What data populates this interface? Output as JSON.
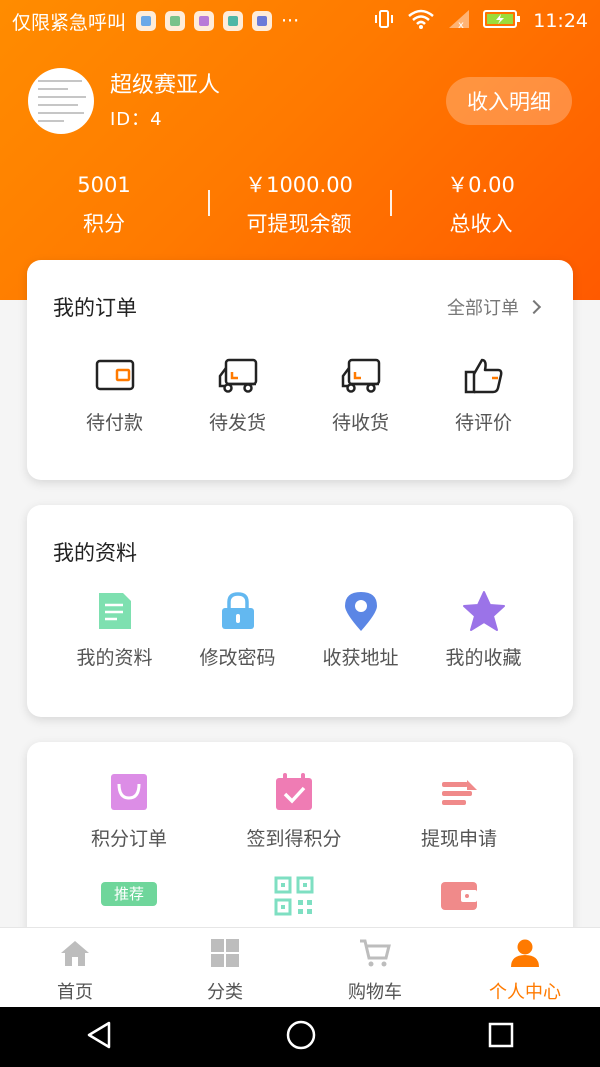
{
  "status_bar": {
    "carrier": "仅限紧急呼叫",
    "dots": "···",
    "time": "11:24"
  },
  "profile": {
    "name": "超级赛亚人",
    "id_text": "ID：4",
    "income_button": "收入明细"
  },
  "stats": [
    {
      "value": "5001",
      "label": "积分"
    },
    {
      "value": "￥1000.00",
      "label": "可提现余额"
    },
    {
      "value": "￥0.00",
      "label": "总收入"
    }
  ],
  "orders": {
    "title": "我的订单",
    "all_orders": "全部订单",
    "items": [
      {
        "label": "待付款",
        "icon": "wallet-icon"
      },
      {
        "label": "待发货",
        "icon": "truck-icon"
      },
      {
        "label": "待收货",
        "icon": "truck-icon"
      },
      {
        "label": "待评价",
        "icon": "thumbs-up-icon"
      }
    ]
  },
  "info": {
    "title": "我的资料",
    "items": [
      {
        "label": "我的资料",
        "icon": "document-icon",
        "color": "#7ee0b0"
      },
      {
        "label": "修改密码",
        "icon": "lock-icon",
        "color": "#63b8f0"
      },
      {
        "label": "收获地址",
        "icon": "location-pin-icon",
        "color": "#5b86e5"
      },
      {
        "label": "我的收藏",
        "icon": "star-icon",
        "color": "#9b73e8"
      }
    ]
  },
  "services": {
    "items": [
      {
        "label": "积分订单",
        "icon": "shopping-bag-icon",
        "color": "#dc8de6"
      },
      {
        "label": "签到得积分",
        "icon": "calendar-check-icon",
        "color": "#ef7cb4"
      },
      {
        "label": "提现申请",
        "icon": "withdraw-icon",
        "color": "#f08a8a"
      }
    ],
    "row2": [
      {
        "badge": "推荐",
        "icon": "recommend-badge-icon",
        "color": "#6fd69b"
      },
      {
        "icon": "qr-code-icon",
        "color": "#7edfc2"
      },
      {
        "icon": "wallet-card-icon",
        "color": "#f08a8a"
      }
    ]
  },
  "tabbar": {
    "tabs": [
      {
        "label": "首页",
        "icon": "home-icon"
      },
      {
        "label": "分类",
        "icon": "grid-icon"
      },
      {
        "label": "购物车",
        "icon": "cart-icon"
      },
      {
        "label": "个人中心",
        "icon": "person-icon",
        "active": true
      }
    ],
    "accent": "#ff7a00"
  },
  "colors": {
    "header_gradient_start": "#ff8c00",
    "header_gradient_end": "#ff5a00",
    "accent": "#ff7a00"
  }
}
